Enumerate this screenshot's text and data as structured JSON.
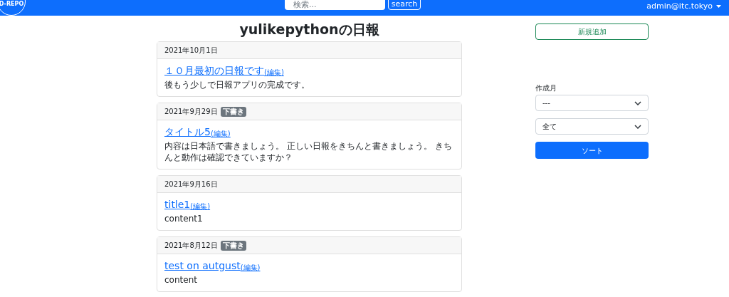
{
  "navbar": {
    "logo": "D-REPO",
    "search": {
      "placeholder": "検索..."
    },
    "search_button": "search",
    "user_menu": "admin@itc.tokyo"
  },
  "page_title": "yulikepythonの日報",
  "reports": [
    {
      "date": "2021年10月1日",
      "draft": false,
      "title": "１０月最初の日報です",
      "edit_link": "(編集)",
      "content": "後もう少しで日報アプリの完成です。"
    },
    {
      "date": "2021年9月29日",
      "draft": true,
      "draft_badge": "下書き",
      "title": "タイトル5",
      "edit_link": "(編集)",
      "content": "内容は日本語で書きましょう。 正しい日報をきちんと書きましょう。 きちんと動作は確認できていますか？"
    },
    {
      "date": "2021年9月16日",
      "draft": false,
      "title": "title1",
      "edit_link": "(編集)",
      "content": "content1"
    },
    {
      "date": "2021年8月12日",
      "draft": true,
      "draft_badge": "下書き",
      "title": "test on autgust",
      "edit_link": "(編集)",
      "content": "content"
    }
  ],
  "sidebar": {
    "new_button": "新規追加",
    "month_label": "作成月",
    "month_select": "---",
    "status_select": "全て",
    "sort_button": "ソート"
  }
}
